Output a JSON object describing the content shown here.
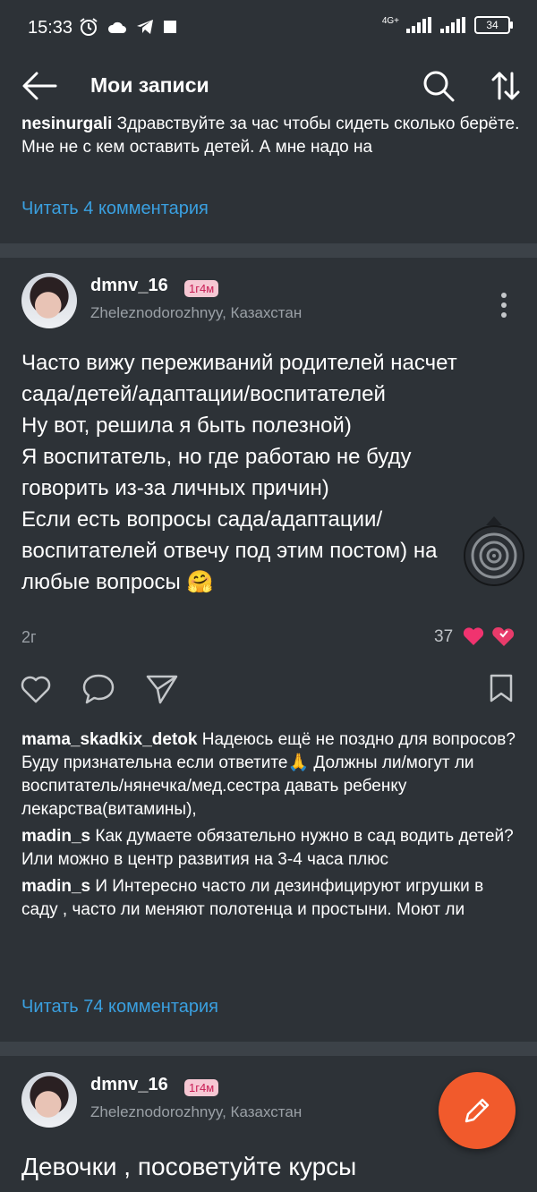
{
  "status_bar": {
    "time": "15:33",
    "network": "4G+",
    "battery": "34"
  },
  "header": {
    "title": "Мои записи"
  },
  "prev_post": {
    "comment_user": "nesinurgali",
    "comment_text": "Здравствуйте за час чтобы сидеть сколько берёте.  Мне не с кем оставить детей. А мне надо на",
    "read_comments": "Читать 4 комментария"
  },
  "post1": {
    "username": "dmnv_16",
    "badge": "1г4м",
    "location": "Zheleznodorozhnyy, Казахстан",
    "text_lines": [
      "Часто вижу переживаний родителей насчет",
      "сада/детей/адаптации/воспитателей",
      "Ну вот, решила я быть полезной)",
      "Я воспитатель, но где работаю не буду",
      "говорить из-за личных причин)",
      "Если есть вопросы сада/адаптации/",
      "воспитателей отвечу под этим постом) на",
      "любые вопросы 🤗"
    ],
    "age": "2г",
    "likes": "37",
    "comments": [
      {
        "user": "mama_skadkix_detok",
        "text": "Надеюсь ещё не поздно для вопросов? Буду признательна если ответите🙏 Должны ли/могут ли воспитатель/нянечка/мед.сестра давать ребенку лекарства(витамины),"
      },
      {
        "user": "madin_s",
        "text": "Как думаете обязательно нужно в сад водить детей? Или можно в центр развития на 3-4 часа плюс"
      },
      {
        "user": "madin_s",
        "text": "И Интересно часто ли дезинфицируют игрушки в саду , часто ли меняют полотенца и простыни. Моют ли"
      }
    ],
    "read_comments": "Читать 74 комментария"
  },
  "post2": {
    "username": "dmnv_16",
    "badge": "1г4м",
    "location": "Zheleznodorozhnyy, Казахстан",
    "text_start": "Девочки , посоветуйте курсы"
  },
  "colors": {
    "background": "#2d3237",
    "link": "#3aa0e0",
    "accent": "#f15a2c",
    "heart": "#f0336f"
  }
}
